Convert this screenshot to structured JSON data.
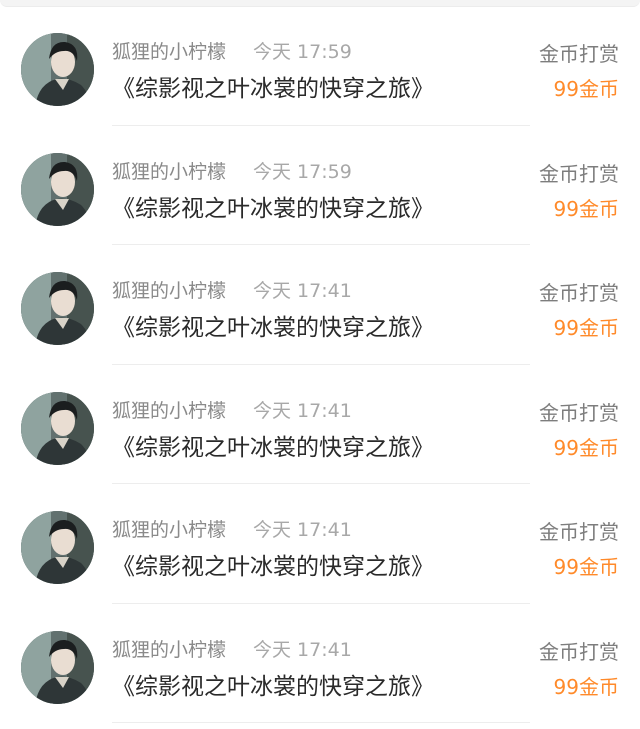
{
  "items": [
    {
      "user": "狐狸的小柠檬",
      "time": "今天 17:59",
      "book": "《综影视之叶冰裳的快穿之旅》",
      "tip_type": "金币打赏",
      "amount": "99金币"
    },
    {
      "user": "狐狸的小柠檬",
      "time": "今天 17:59",
      "book": "《综影视之叶冰裳的快穿之旅》",
      "tip_type": "金币打赏",
      "amount": "99金币"
    },
    {
      "user": "狐狸的小柠檬",
      "time": "今天 17:41",
      "book": "《综影视之叶冰裳的快穿之旅》",
      "tip_type": "金币打赏",
      "amount": "99金币"
    },
    {
      "user": "狐狸的小柠檬",
      "time": "今天 17:41",
      "book": "《综影视之叶冰裳的快穿之旅》",
      "tip_type": "金币打赏",
      "amount": "99金币"
    },
    {
      "user": "狐狸的小柠檬",
      "time": "今天 17:41",
      "book": "《综影视之叶冰裳的快穿之旅》",
      "tip_type": "金币打赏",
      "amount": "99金币"
    },
    {
      "user": "狐狸的小柠檬",
      "time": "今天 17:41",
      "book": "《综影视之叶冰裳的快穿之旅》",
      "tip_type": "金币打赏",
      "amount": "99金币"
    }
  ],
  "colors": {
    "accent": "#ff8a2a",
    "username": "#8a8a8a",
    "timestamp": "#a8a8a8",
    "title": "#2a2a2a"
  }
}
